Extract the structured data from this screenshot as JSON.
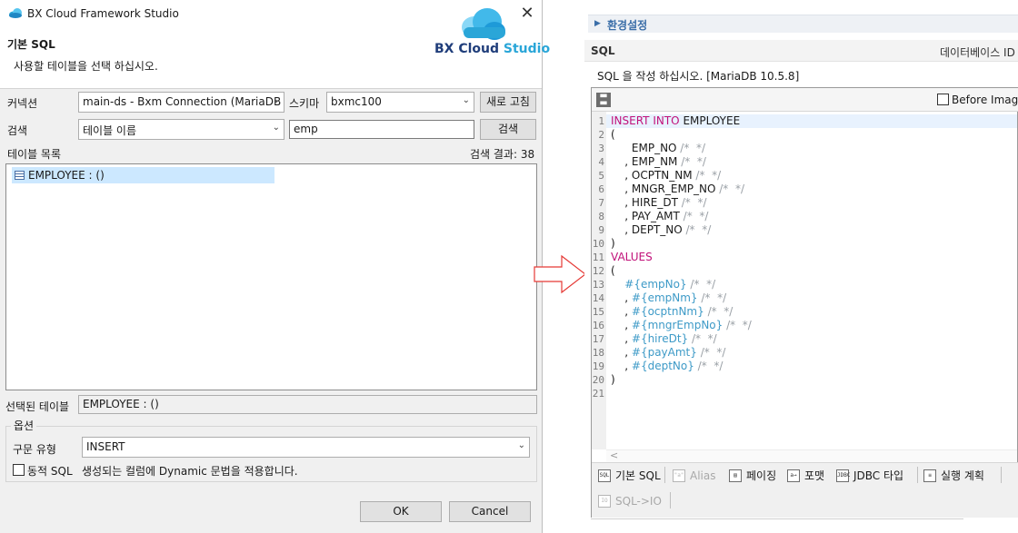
{
  "window": {
    "title": "BX Cloud Framework Studio",
    "close_glyph": "✕"
  },
  "header": {
    "title": "기본 SQL",
    "description": "사용할 테이블을 선택 하십시오.",
    "logo_bx": "BX Cloud",
    "logo_studio": "Studio",
    "logo_icon": "cloud-icon"
  },
  "connection": {
    "label": "커넥션",
    "value": "main-ds - Bxm Connection (MariaDB",
    "schema_label": "스키마",
    "schema_value": "bxmc100",
    "refresh_button": "새로 고침"
  },
  "search": {
    "label": "검색",
    "type_value": "테이블 이름",
    "query": "emp",
    "button": "검색"
  },
  "table_list": {
    "label": "테이블 목록",
    "result_count": "검색 결과: 38",
    "items": [
      "EMPLOYEE : ()"
    ]
  },
  "selected_table": {
    "label": "선택된 테이블",
    "value": "EMPLOYEE : ()"
  },
  "options": {
    "group_title": "옵션",
    "syntax_label": "구문 유형",
    "syntax_value": "INSERT",
    "dynamic_label": "동적 SQL",
    "dynamic_desc": "생성되는 컬럼에 Dynamic 문법을 적용합니다.",
    "dynamic_checked": false
  },
  "dialog_buttons": {
    "ok": "OK",
    "cancel": "Cancel"
  },
  "right_panel": {
    "settings_label": "환경설정",
    "sql_header": "SQL",
    "db_id_label": "데이터베이스 ID",
    "description": "SQL 을 작성 하십시오. [MariaDB 10.5.8]",
    "before_image_label": "Before Image",
    "before_image_checked": false,
    "line_numbers": [
      "1",
      "2",
      "3",
      "4",
      "5",
      "6",
      "7",
      "8",
      "9",
      "10",
      "11",
      "12",
      "13",
      "14",
      "15",
      "16",
      "17",
      "18",
      "19",
      "20",
      "21"
    ],
    "sql": {
      "l1_kw": "INSERT INTO",
      "l1_table": " EMPLOYEE",
      "open_paren": "(",
      "close_paren": ")",
      "values_kw": "VALUES",
      "comment": " /*  */",
      "columns": [
        {
          "prefix": "      ",
          "name": "EMP_NO"
        },
        {
          "prefix": "    , ",
          "name": "EMP_NM"
        },
        {
          "prefix": "    , ",
          "name": "OCPTN_NM"
        },
        {
          "prefix": "    , ",
          "name": "MNGR_EMP_NO"
        },
        {
          "prefix": "    , ",
          "name": "HIRE_DT"
        },
        {
          "prefix": "    , ",
          "name": "PAY_AMT"
        },
        {
          "prefix": "    , ",
          "name": "DEPT_NO"
        }
      ],
      "params": [
        {
          "prefix": "    ",
          "name": "#{empNo}"
        },
        {
          "prefix": "    , ",
          "name": "#{empNm}"
        },
        {
          "prefix": "    , ",
          "name": "#{ocptnNm}"
        },
        {
          "prefix": "    , ",
          "name": "#{mngrEmpNo}"
        },
        {
          "prefix": "    , ",
          "name": "#{hireDt}"
        },
        {
          "prefix": "    , ",
          "name": "#{payAmt}"
        },
        {
          "prefix": "    , ",
          "name": "#{deptNo}"
        }
      ]
    },
    "scroll_left_glyph": "<",
    "tabs": [
      {
        "label": "기본 SQL",
        "icon": "sql-icon",
        "enabled": true
      },
      {
        "label": "Alias",
        "icon": "alias-icon",
        "enabled": false
      },
      {
        "label": "페이징",
        "icon": "paging-icon",
        "enabled": true
      },
      {
        "label": "포맷",
        "icon": "format-icon",
        "enabled": true
      },
      {
        "label": "JDBC 타입",
        "icon": "jdbc-icon",
        "enabled": true
      },
      {
        "label": "실행 계획",
        "icon": "explain-plan-icon",
        "enabled": true
      },
      {
        "label": "SQL->IO",
        "icon": "sql-io-icon",
        "enabled": false
      }
    ]
  },
  "colors": {
    "keyword": "#c1127a",
    "comment": "#9aa0a6",
    "parameter": "#3d9ac7",
    "selection": "#cce8ff",
    "arrow": "#e53935"
  }
}
